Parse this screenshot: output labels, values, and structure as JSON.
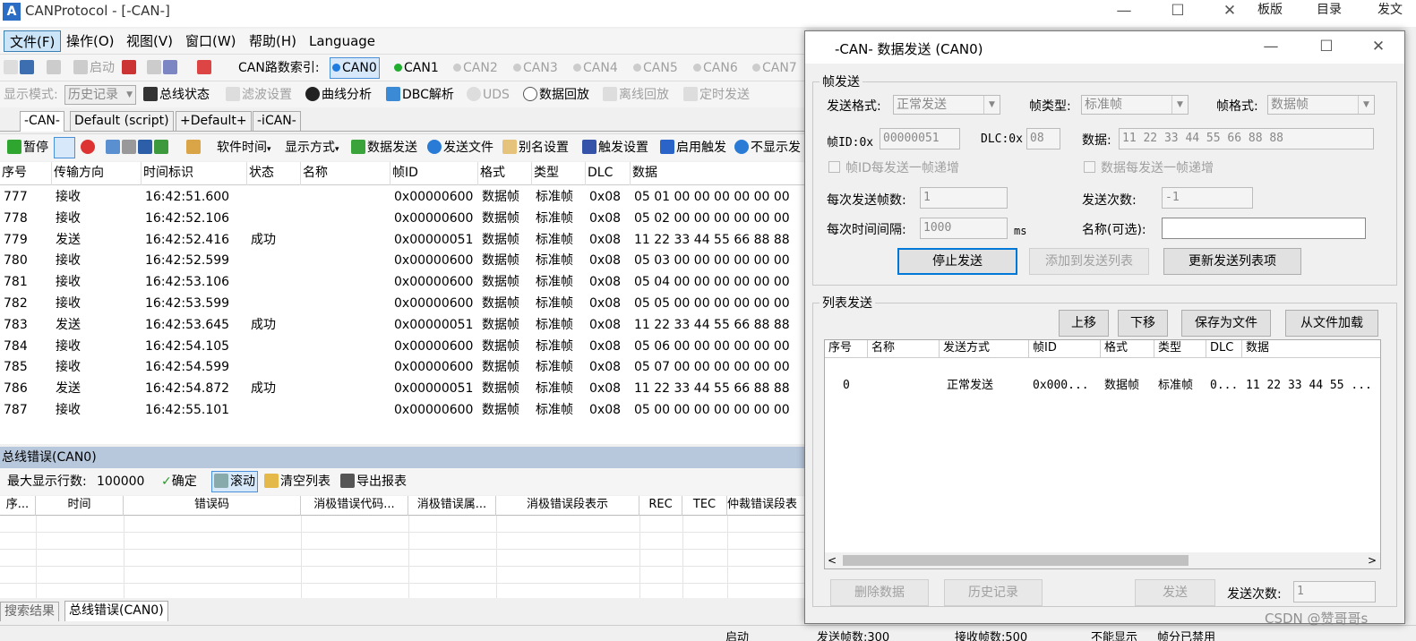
{
  "app": {
    "title": "CANProtocol - [-CAN-]",
    "logo": "A"
  },
  "background": {
    "items": [
      "板版",
      "目录",
      "发文"
    ]
  },
  "menu": [
    "文件(F)",
    "操作(O)",
    "视图(V)",
    "窗口(W)",
    "帮助(H)",
    "Language"
  ],
  "toolbar1": {
    "start": "启动",
    "can_index_label": "CAN路数索引:",
    "channels": [
      "CAN0",
      "CAN1",
      "CAN2",
      "CAN3",
      "CAN4",
      "CAN5",
      "CAN6",
      "CAN7"
    ]
  },
  "toolbar2": {
    "display_mode_label": "显示模式:",
    "display_mode_value": "历史记录",
    "bus_status": "总线状态",
    "filter": "滤波设置",
    "curve": "曲线分析",
    "dbc": "DBC解析",
    "uds": "UDS",
    "replay": "数据回放",
    "offline_replay": "离线回放",
    "timed_send": "定时发送"
  },
  "tabs": [
    "-CAN-",
    "Default (script)",
    "+Default+",
    "-iCAN-"
  ],
  "toolbar3": {
    "pause": "暂停",
    "soft_time": "软件时间",
    "display_style": "显示方式",
    "data_send": "数据发送",
    "send_file": "发送文件",
    "alias": "别名设置",
    "trigger_set": "触发设置",
    "enable_trigger": "启用触发",
    "no_display": "不显示发"
  },
  "grid": {
    "columns": [
      "序号",
      "传输方向",
      "时间标识",
      "状态",
      "名称",
      "帧ID",
      "格式",
      "类型",
      "DLC",
      "数据"
    ],
    "rows": [
      [
        "777",
        "接收",
        "16:42:51.600",
        "",
        "",
        "0x00000600",
        "数据帧",
        "标准帧",
        "0x08",
        "05 01 00 00 00 00 00 00"
      ],
      [
        "778",
        "接收",
        "16:42:52.106",
        "",
        "",
        "0x00000600",
        "数据帧",
        "标准帧",
        "0x08",
        "05 02 00 00 00 00 00 00"
      ],
      [
        "779",
        "发送",
        "16:42:52.416",
        "成功",
        "",
        "0x00000051",
        "数据帧",
        "标准帧",
        "0x08",
        "11 22 33 44 55 66 88 88"
      ],
      [
        "780",
        "接收",
        "16:42:52.599",
        "",
        "",
        "0x00000600",
        "数据帧",
        "标准帧",
        "0x08",
        "05 03 00 00 00 00 00 00"
      ],
      [
        "781",
        "接收",
        "16:42:53.106",
        "",
        "",
        "0x00000600",
        "数据帧",
        "标准帧",
        "0x08",
        "05 04 00 00 00 00 00 00"
      ],
      [
        "782",
        "接收",
        "16:42:53.599",
        "",
        "",
        "0x00000600",
        "数据帧",
        "标准帧",
        "0x08",
        "05 05 00 00 00 00 00 00"
      ],
      [
        "783",
        "发送",
        "16:42:53.645",
        "成功",
        "",
        "0x00000051",
        "数据帧",
        "标准帧",
        "0x08",
        "11 22 33 44 55 66 88 88"
      ],
      [
        "784",
        "接收",
        "16:42:54.105",
        "",
        "",
        "0x00000600",
        "数据帧",
        "标准帧",
        "0x08",
        "05 06 00 00 00 00 00 00"
      ],
      [
        "785",
        "接收",
        "16:42:54.599",
        "",
        "",
        "0x00000600",
        "数据帧",
        "标准帧",
        "0x08",
        "05 07 00 00 00 00 00 00"
      ],
      [
        "786",
        "发送",
        "16:42:54.872",
        "成功",
        "",
        "0x00000051",
        "数据帧",
        "标准帧",
        "0x08",
        "11 22 33 44 55 66 88 88"
      ],
      [
        "787",
        "接收",
        "16:42:55.101",
        "",
        "",
        "0x00000600",
        "数据帧",
        "标准帧",
        "0x08",
        "05 00 00 00 00 00 00 00"
      ]
    ]
  },
  "error_panel": {
    "title": "总线错误(CAN0)",
    "max_rows_label": "最大显示行数:",
    "max_rows_value": "100000",
    "confirm": "确定",
    "scroll": "滚动",
    "clear": "清空列表",
    "export": "导出报表",
    "columns": [
      "序...",
      "时间",
      "错误码",
      "消极错误代码...",
      "消极错误属...",
      "消极错误段表示",
      "REC",
      "TEC",
      "仲裁错误段表"
    ]
  },
  "bottom_tabs": [
    "搜索结果",
    "总线错误(CAN0)"
  ],
  "status_bar": [
    "启动",
    "发送帧数:300",
    "接收帧数:500",
    "不能显示",
    "帧分已禁用"
  ],
  "dialog": {
    "title": "-CAN- 数据发送 (CAN0)",
    "frame_group": "帧发送",
    "send_format_label": "发送格式:",
    "send_format_value": "正常发送",
    "frame_type_label": "帧类型:",
    "frame_type_value": "标准帧",
    "frame_format_label": "帧格式:",
    "frame_format_value": "数据帧",
    "frame_id_label": "帧ID:0x",
    "frame_id_value": "00000051",
    "dlc_label": "DLC:0x",
    "dlc_value": "08",
    "data_label": "数据:",
    "data_value": "11 22 33 44 55 66 88 88",
    "id_increment": "帧ID每发送一帧递增",
    "data_increment": "数据每发送一帧递增",
    "frames_per_send_label": "每次发送帧数:",
    "frames_per_send_value": "1",
    "send_count_label": "发送次数:",
    "send_count_value": "-1",
    "interval_label": "每次时间间隔:",
    "interval_value": "1000",
    "interval_unit": "ms",
    "name_label": "名称(可选):",
    "name_value": "",
    "stop_btn": "停止发送",
    "add_btn": "添加到发送列表",
    "update_btn": "更新发送列表项",
    "list_group": "列表发送",
    "up_btn": "上移",
    "down_btn": "下移",
    "save_btn": "保存为文件",
    "load_btn": "从文件加载",
    "list_columns": [
      "序号",
      "名称",
      "发送方式",
      "帧ID",
      "格式",
      "类型",
      "DLC",
      "数据"
    ],
    "list_rows": [
      [
        "0",
        "",
        "正常发送",
        "0x000...",
        "数据帧",
        "标准帧",
        "0...",
        "11 22 33 44 55 ..."
      ]
    ],
    "delete_btn": "删除数据",
    "history_btn": "历史记录",
    "send_btn": "发送",
    "bottom_count_label": "发送次数:",
    "bottom_count_value": "1"
  },
  "watermark": "CSDN @赞哥哥s",
  "colors": {
    "accent": "#0078d7",
    "selected_menu": "#cce4f7",
    "section_bar": "#b8c8dc"
  }
}
